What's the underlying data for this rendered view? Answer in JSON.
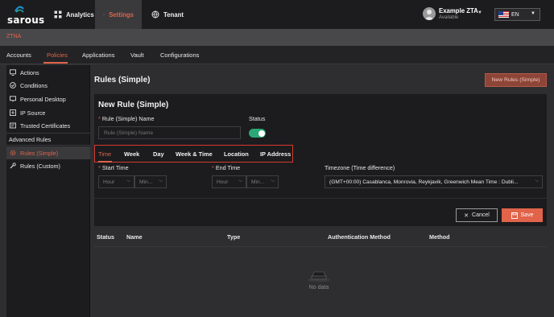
{
  "header": {
    "logo_text": "sarous",
    "nav": [
      {
        "label": "Analytics",
        "icon": "grid-icon"
      },
      {
        "label": "Settings",
        "icon": "gear-icon",
        "active": true
      },
      {
        "label": "Tenant",
        "icon": "globe-icon"
      }
    ],
    "user": {
      "name": "Example ZTA",
      "status": "Available"
    },
    "language": "EN"
  },
  "section": "ZTNA",
  "subnav": [
    {
      "label": "Accounts"
    },
    {
      "label": "Policies",
      "active": true
    },
    {
      "label": "Applications"
    },
    {
      "label": "Vault"
    },
    {
      "label": "Configurations"
    }
  ],
  "sidebar": {
    "items": [
      {
        "label": "Actions",
        "icon": "monitor-icon"
      },
      {
        "label": "Conditions",
        "icon": "check-circle-icon"
      },
      {
        "label": "Personal Desktop",
        "icon": "desktop-icon"
      },
      {
        "label": "IP Source",
        "icon": "network-icon"
      },
      {
        "label": "Trusted Certificates",
        "icon": "certificate-icon"
      }
    ],
    "section_label": "Advanced Rules",
    "advanced": [
      {
        "label": "Rules (Simple)",
        "icon": "gear-icon",
        "active": true
      },
      {
        "label": "Rules (Custom)",
        "icon": "wrench-icon"
      }
    ]
  },
  "main": {
    "title": "Rules (Simple)",
    "new_button": "New Rules (Simple)",
    "form": {
      "title": "New Rule (Simple)",
      "name_label": "Rule (Simple) Name",
      "name_placeholder": "Rule (Simple) Name",
      "status_label": "Status",
      "status_on": true,
      "tabs": [
        "Time",
        "Week",
        "Day",
        "Week & Time",
        "Location",
        "IP Address"
      ],
      "active_tab": "Time",
      "start_time_label": "Start Time",
      "end_time_label": "End Time",
      "hour_placeholder": "Hour",
      "minute_placeholder": "Min...",
      "timezone_label": "Timezone (Time difference)",
      "timezone_value": "(GMT+00:00) Casablanca, Monrovia, Reykjavik, Greenwich Mean Time : Dubli...",
      "cancel_label": "Cancel",
      "save_label": "Save"
    },
    "table": {
      "columns": [
        "Status",
        "Name",
        "Type",
        "Authentication Method",
        "Method"
      ],
      "empty_text": "No data"
    }
  },
  "colors": {
    "accent": "#e0634a",
    "toggle_on": "#2aa876",
    "highlight_border": "#d43a2f"
  }
}
